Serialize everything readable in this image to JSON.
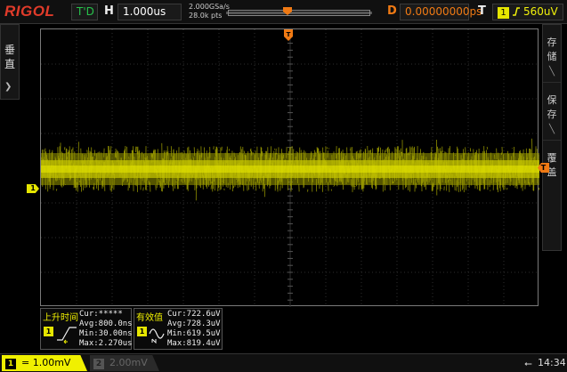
{
  "topbar": {
    "logo": "RIGOL",
    "run_status": "T'D",
    "horizontal_label": "H",
    "timebase": "1.000us",
    "sample_rate": "2.000GSa/s",
    "memory_depth": "28.0k pts",
    "delay_label": "D",
    "delay_value": "0.00000000ps",
    "trigger_label": "T",
    "trigger_source": "1",
    "trigger_level": "560uV"
  },
  "left_tab": {
    "label": "垂直"
  },
  "right_panel": {
    "items": [
      {
        "label": "存储"
      },
      {
        "label": "保存"
      },
      {
        "label": "覆盖"
      }
    ]
  },
  "markers": {
    "ch1": "1",
    "trigger_level": "T"
  },
  "measurements": {
    "rise_time": {
      "title": "上升时间",
      "channel": "1",
      "cur": "Cur:*****",
      "avg": "Avg:800.0ns",
      "min": "Min:30.00ns",
      "max": "Max:2.270us"
    },
    "rms": {
      "title": "有效值",
      "channel": "1",
      "cur": "Cur:722.6uV",
      "avg": "Avg:728.3uV",
      "min": "Min:619.5uV",
      "max": "Max:819.4uV"
    }
  },
  "bottombar": {
    "ch1_num": "1",
    "ch1_scale": "= 1.00mV",
    "ch2_num": "2",
    "ch2_scale": "2.00mV",
    "time": "14:34"
  },
  "colors": {
    "ch1": "#e6e600",
    "trigger": "#f07a14",
    "run_status": "#27c24b"
  },
  "icons": {
    "trigger_edge": "rising-edge-icon",
    "usb": "usb-icon"
  }
}
